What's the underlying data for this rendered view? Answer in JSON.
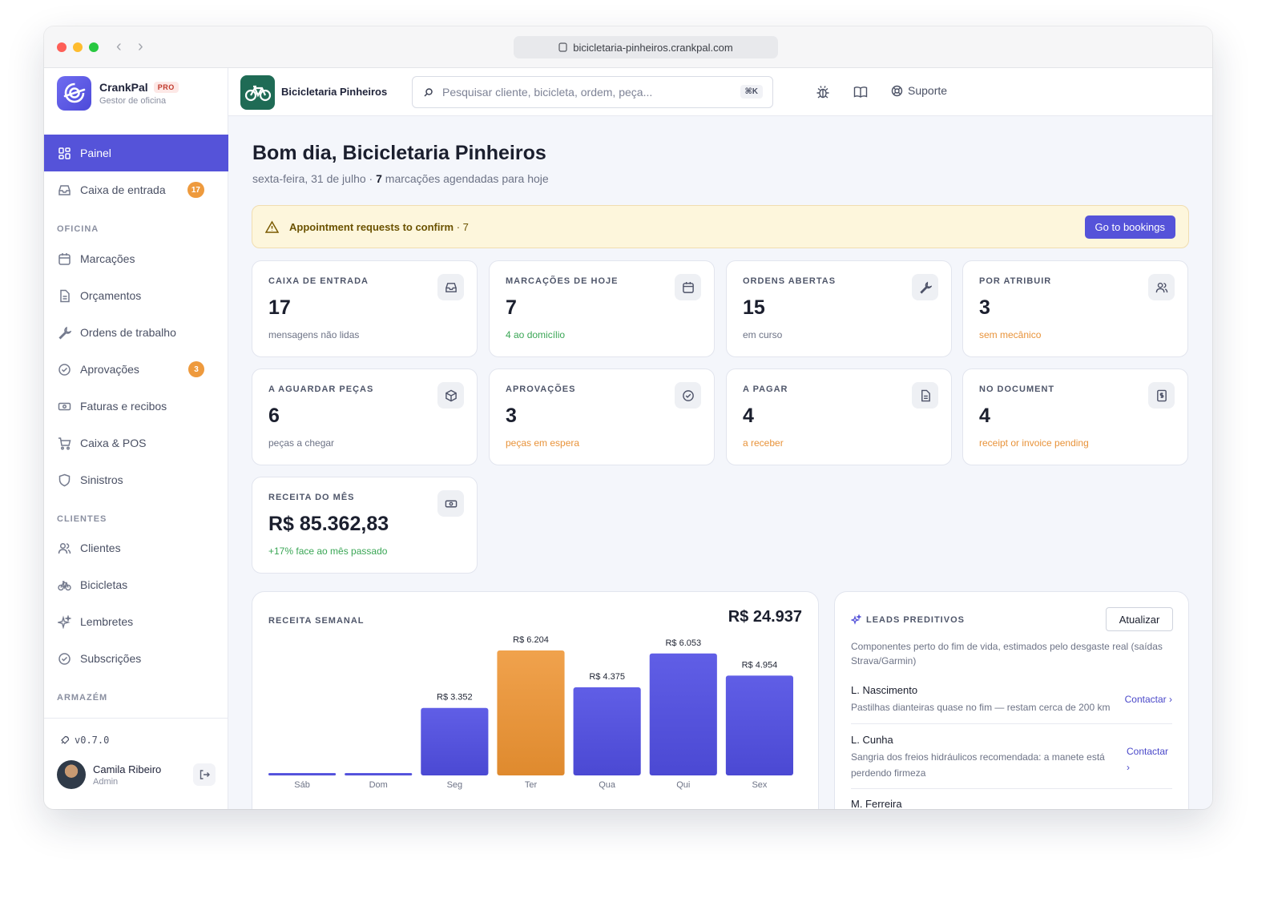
{
  "browser": {
    "url": "bicicletaria-pinheiros.crankpal.com"
  },
  "brand": {
    "name": "CrankPal",
    "badge": "PRO",
    "subtitle": "Gestor de oficina"
  },
  "sidebar": {
    "items": [
      {
        "label": "Painel",
        "icon": "grid-icon",
        "active": true
      },
      {
        "label": "Caixa de entrada",
        "icon": "inbox-icon",
        "badge": "17"
      }
    ],
    "sections": [
      {
        "title": "OFICINA",
        "items": [
          {
            "label": "Marcações",
            "icon": "calendar-icon"
          },
          {
            "label": "Orçamentos",
            "icon": "document-icon"
          },
          {
            "label": "Ordens de trabalho",
            "icon": "wrench-icon"
          },
          {
            "label": "Aprovações",
            "icon": "check-circle-icon",
            "badge": "3"
          },
          {
            "label": "Faturas e recibos",
            "icon": "cash-icon"
          },
          {
            "label": "Caixa & POS",
            "icon": "cart-icon"
          },
          {
            "label": "Sinistros",
            "icon": "shield-icon"
          }
        ]
      },
      {
        "title": "CLIENTES",
        "items": [
          {
            "label": "Clientes",
            "icon": "users-icon"
          },
          {
            "label": "Bicicletas",
            "icon": "bicycle-icon"
          },
          {
            "label": "Lembretes",
            "icon": "sparkles-icon"
          },
          {
            "label": "Subscrições",
            "icon": "check-circle-icon"
          }
        ]
      },
      {
        "title": "ARMAZÉM",
        "items": []
      }
    ],
    "version": "v0.7.0",
    "user": {
      "name": "Camila Ribeiro",
      "role": "Admin"
    }
  },
  "topbar": {
    "shop_name": "Bicicletaria Pinheiros",
    "search_placeholder": "Pesquisar cliente, bicicleta, ordem, peça...",
    "search_shortcut": "⌘K",
    "support_label": "Suporte"
  },
  "main": {
    "greeting": "Bom dia, Bicicletaria Pinheiros",
    "date": "sexta-feira, 31 de julho · ",
    "appointments_count": "7",
    "appointments_text": " marcações agendadas para hoje",
    "alert": {
      "title": "Appointment requests to confirm",
      "count": " · 7",
      "button": "Go to bookings"
    },
    "cards": [
      {
        "label": "CAIXA DE ENTRADA",
        "value": "17",
        "sub": "mensagens não lidas",
        "tone": "gray",
        "icon": "inbox-icon"
      },
      {
        "label": "MARCAÇÕES DE HOJE",
        "value": "7",
        "sub": "4 ao domicílio",
        "tone": "green",
        "icon": "calendar-icon"
      },
      {
        "label": "ORDENS ABERTAS",
        "value": "15",
        "sub": "em curso",
        "tone": "gray",
        "icon": "wrench-icon"
      },
      {
        "label": "POR ATRIBUIR",
        "value": "3",
        "sub": "sem mecânico",
        "tone": "orange",
        "icon": "users-icon"
      },
      {
        "label": "A AGUARDAR PEÇAS",
        "value": "6",
        "sub": "peças a chegar",
        "tone": "gray",
        "icon": "box-icon"
      },
      {
        "label": "APROVAÇÕES",
        "value": "3",
        "sub": "peças em espera",
        "tone": "orange",
        "icon": "check-circle-icon"
      },
      {
        "label": "A PAGAR",
        "value": "4",
        "sub": "a receber",
        "tone": "orange",
        "icon": "document-icon"
      },
      {
        "label": "NO DOCUMENT",
        "value": "4",
        "sub": "receipt or invoice pending",
        "tone": "orange",
        "icon": "invoice-icon"
      },
      {
        "label": "RECEITA DO MÊS",
        "value": "R$ 85.362,83",
        "sub": "+17% face ao mês passado",
        "tone": "green",
        "icon": "cash-icon"
      }
    ],
    "weekly": {
      "label": "RECEITA SEMANAL",
      "total": "R$ 24.937"
    },
    "leads": {
      "label": "LEADS PREDITIVOS",
      "refresh": "Atualizar",
      "description": "Componentes perto do fim de vida, estimados pelo desgaste real (saídas Strava/Garmin)",
      "items": [
        {
          "name": "L. Nascimento",
          "text": "Pastilhas dianteiras quase no fim — restam cerca de 200 km",
          "action": "Contactar ›"
        },
        {
          "name": "L. Cunha",
          "text": "Sangria dos freios hidráulicos recomendada: a manete está perdendo firmeza",
          "action": "Contactar ›"
        },
        {
          "name": "M. Ferreira",
          "text": "",
          "action": ""
        }
      ]
    }
  },
  "chart_data": {
    "type": "bar",
    "title": "RECEITA SEMANAL",
    "categories": [
      "Sáb",
      "Dom",
      "Seg",
      "Ter",
      "Qua",
      "Qui",
      "Sex"
    ],
    "values": [
      0,
      0,
      3352,
      6204,
      4375,
      6053,
      4954
    ],
    "data_labels": [
      "",
      "",
      "R$ 3.352",
      "R$ 6.204",
      "R$ 4.375",
      "R$ 6.053",
      "R$ 4.954"
    ],
    "highlight_category": "Ter",
    "colors": {
      "bar": "#5553d9",
      "highlight": "#ec9a3f"
    },
    "grid": false
  }
}
